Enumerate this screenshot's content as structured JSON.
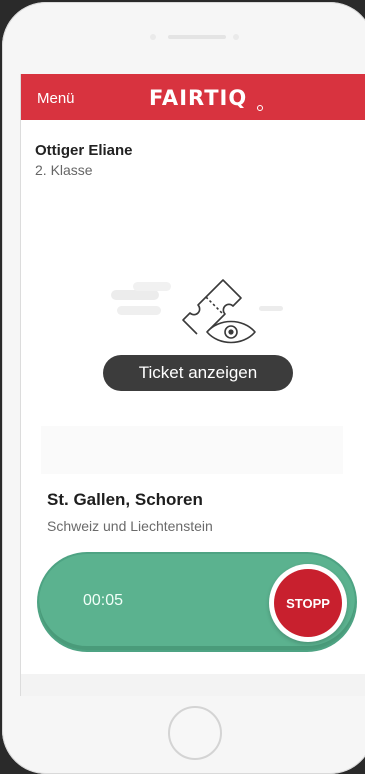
{
  "app": {
    "menu_label": "Menü",
    "brand": "FAIRTIQ"
  },
  "passenger": {
    "name": "Ottiger Eliane",
    "travel_class": "2. Klasse"
  },
  "ticket": {
    "button_label": "Ticket anzeigen",
    "icon": "ticket-eye-icon"
  },
  "location": {
    "station": "St. Gallen, Schoren",
    "region": "Schweiz und Liechtenstein"
  },
  "journey": {
    "elapsed": "00:05",
    "stop_label": "STOPP"
  },
  "colors": {
    "brand_red": "#d8333f",
    "timer_green": "#5bb28f",
    "stop_red": "#c8202e"
  }
}
